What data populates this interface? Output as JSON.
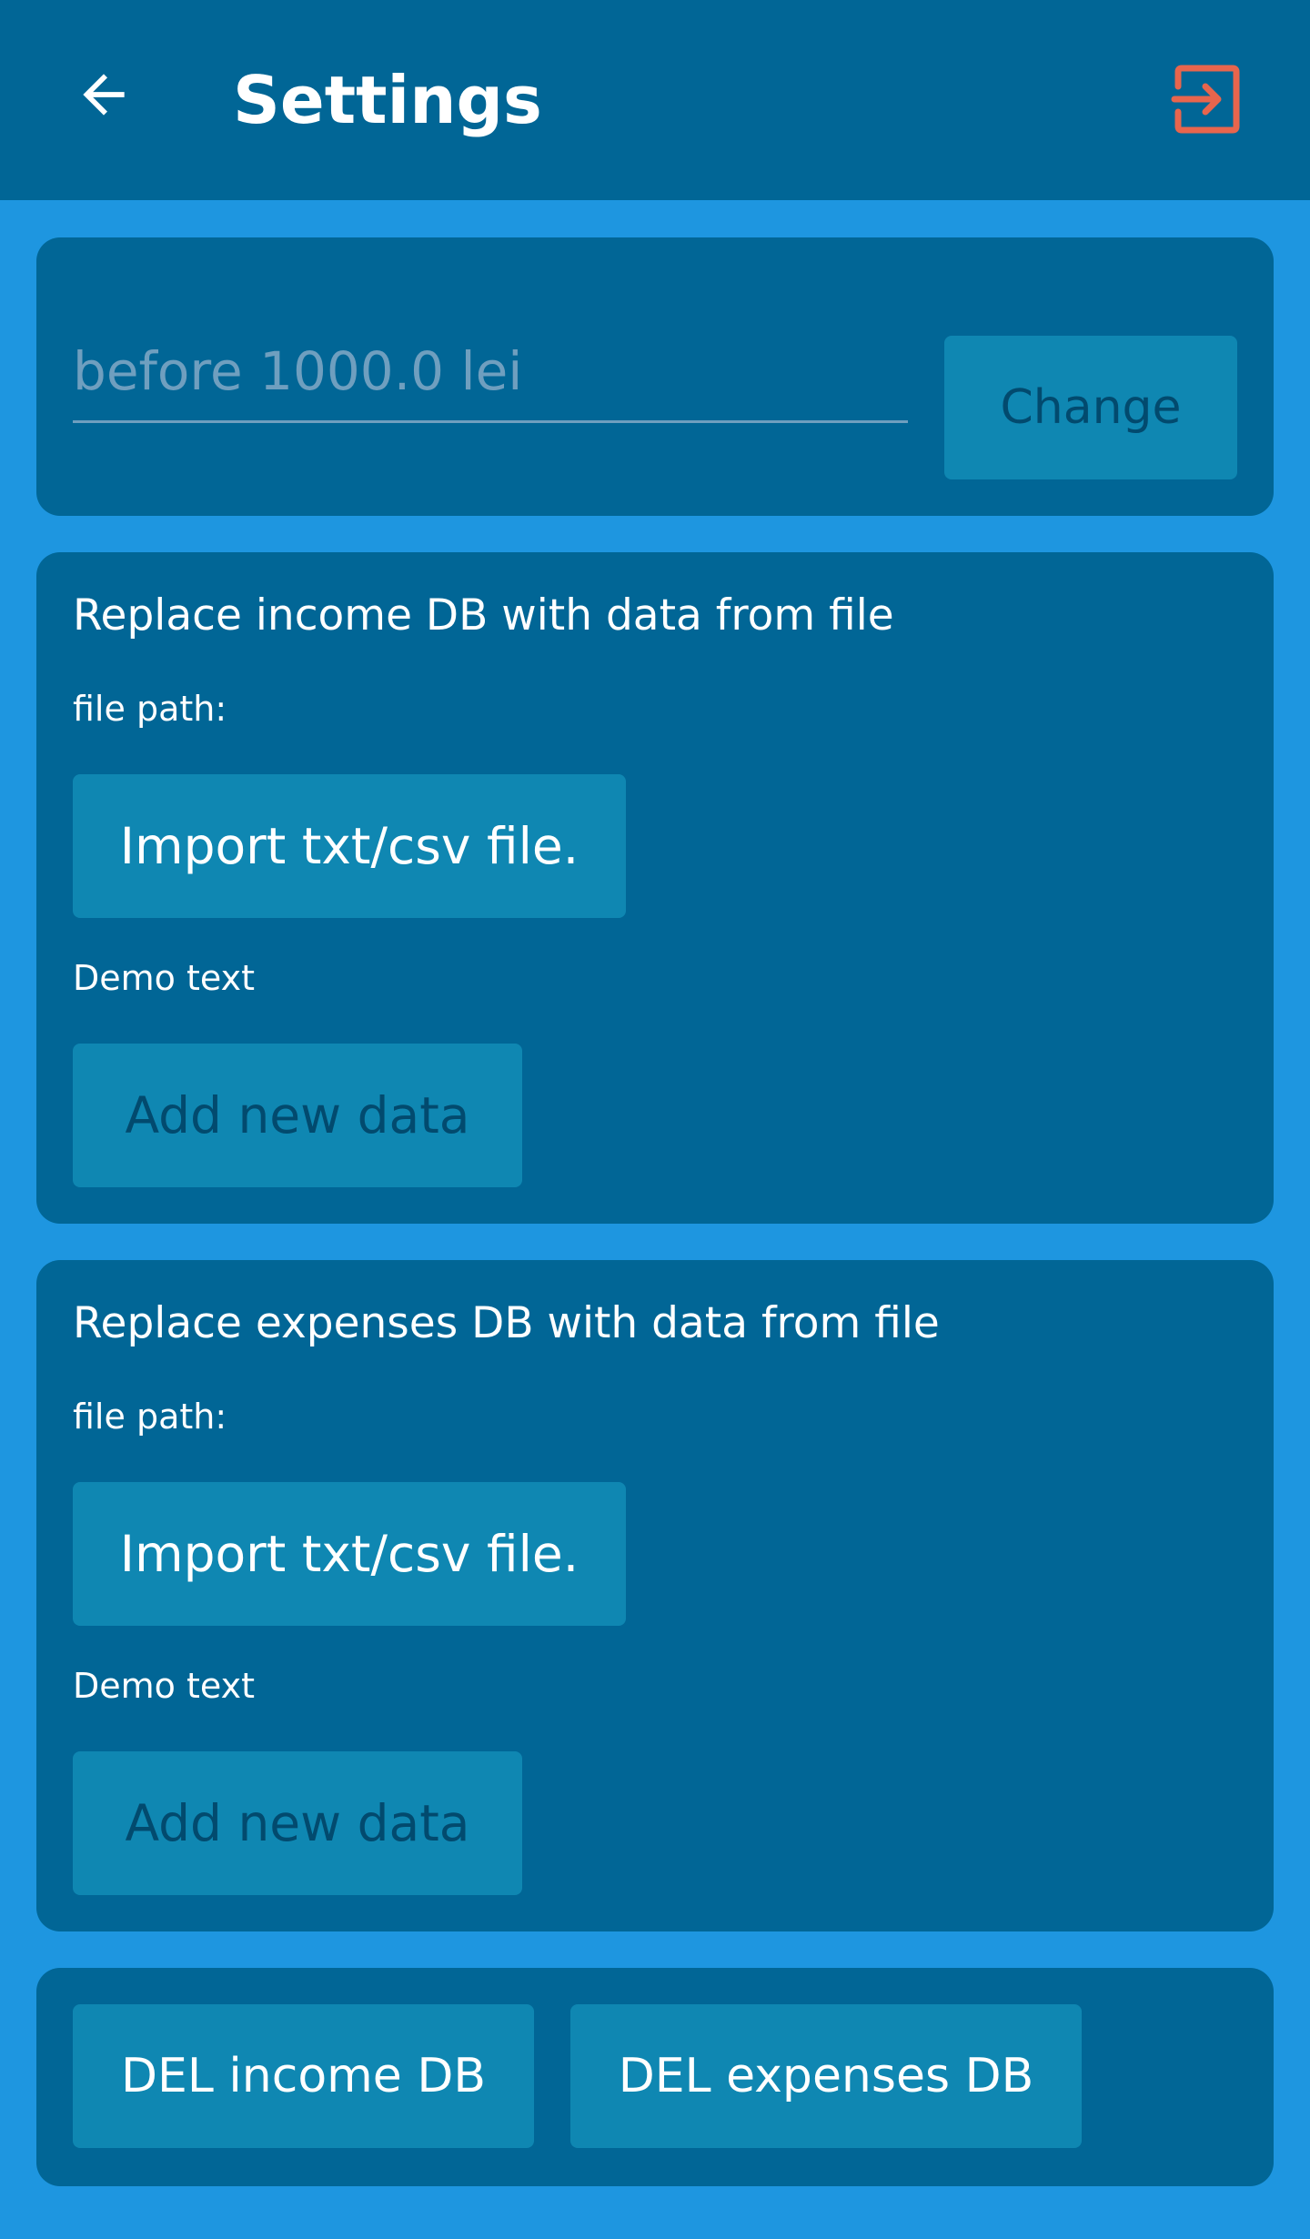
{
  "header": {
    "title": "Settings",
    "back_icon": "arrow-left-icon",
    "logout_icon": "logout-icon",
    "logout_color": "#e8654d"
  },
  "budget": {
    "placeholder": "before 1000.0 lei",
    "value": "",
    "change_label": "Change"
  },
  "income_section": {
    "title": "Replace income DB with data from file",
    "file_path_label": "file path:",
    "import_label": "Import txt/csv file.",
    "demo_text": "Demo text",
    "add_label": "Add new data"
  },
  "expenses_section": {
    "title": "Replace expenses DB with data from file",
    "file_path_label": "file path:",
    "import_label": "Import txt/csv file.",
    "demo_text": "Demo text",
    "add_label": "Add new data"
  },
  "delete_section": {
    "del_income_label": "DEL income DB",
    "del_expenses_label": "DEL expenses DB"
  },
  "colors": {
    "background": "#1e96e0",
    "surface": "#016696",
    "button": "#0f87b2",
    "button_text_disabled": "#024a6e",
    "accent": "#e8654d"
  }
}
